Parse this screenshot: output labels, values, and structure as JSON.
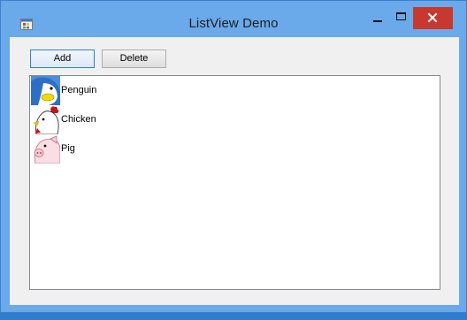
{
  "window": {
    "title": "ListView Demo"
  },
  "toolbar": {
    "add_label": "Add",
    "delete_label": "Delete"
  },
  "listview": {
    "items": [
      {
        "label": "Penguin",
        "icon": "penguin-icon"
      },
      {
        "label": "Chicken",
        "icon": "chicken-icon"
      },
      {
        "label": "Pig",
        "icon": "pig-icon"
      }
    ]
  },
  "colors": {
    "title_bar": "#6aa9ea",
    "close_button": "#c7392f",
    "client_background": "#f0f0f0",
    "default_button_border": "#2f80d8"
  }
}
